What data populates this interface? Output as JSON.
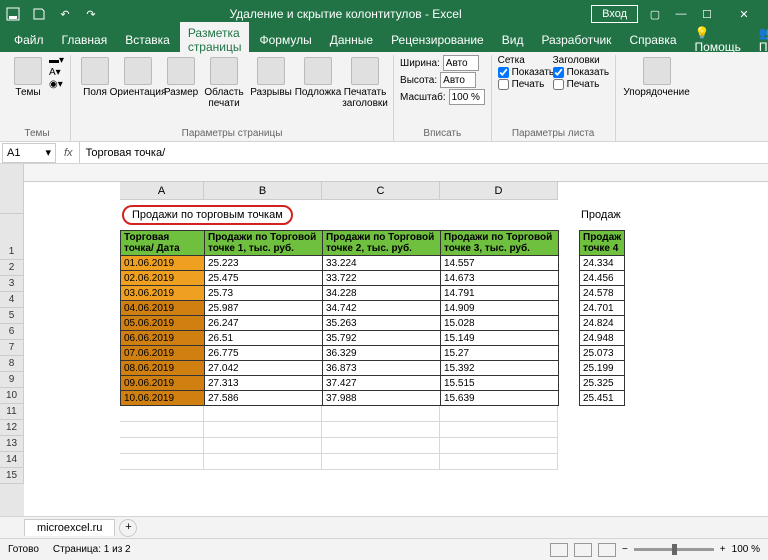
{
  "titlebar": {
    "title": "Удаление и скрытие колонтитулов - Excel",
    "login": "Вход"
  },
  "menu": {
    "items": [
      "Файл",
      "Главная",
      "Вставка",
      "Разметка страницы",
      "Формулы",
      "Данные",
      "Рецензирование",
      "Вид",
      "Разработчик",
      "Справка"
    ],
    "active": 3,
    "help_icon": "?",
    "assist": "Помощь",
    "share": "Поделиться"
  },
  "ribbon": {
    "themes": {
      "label": "Темы",
      "btn": "Темы"
    },
    "page_setup": {
      "label": "Параметры страницы",
      "btns": [
        "Поля",
        "Ориентация",
        "Размер",
        "Область печати",
        "Разрывы",
        "Подложка",
        "Печатать заголовки"
      ]
    },
    "fit": {
      "label": "Вписать",
      "width_lbl": "Ширина:",
      "width_val": "Авто",
      "height_lbl": "Высота:",
      "height_val": "Авто",
      "scale_lbl": "Масштаб:",
      "scale_val": "100 %"
    },
    "sheet_opts": {
      "label": "Параметры листа",
      "grid_lbl": "Сетка",
      "head_lbl": "Заголовки",
      "show": "Показать",
      "print": "Печать"
    },
    "arrange": {
      "label": "",
      "btn": "Упорядочение"
    }
  },
  "formula": {
    "cell": "A1",
    "value": "Торговая точка/"
  },
  "cols": [
    "A",
    "B",
    "C",
    "D"
  ],
  "header_text": "Продажи по торговым точкам",
  "header_text2": "Продаж",
  "table": {
    "headers": [
      "Торговая точка/ Дата",
      "Продажи по Торговой точке 1, тыс. руб.",
      "Продажи по Торговой точке 2, тыс. руб.",
      "Продажи по Торговой точке 3, тыс. руб."
    ],
    "header_p2": "Продаж",
    "header_p2b": "точке 4",
    "rows": [
      {
        "d": "01.06.2019",
        "v": [
          "25.223",
          "33.224",
          "14.557"
        ],
        "p2": "24.334"
      },
      {
        "d": "02.06.2019",
        "v": [
          "25.475",
          "33.722",
          "14.673"
        ],
        "p2": "24.456"
      },
      {
        "d": "03.06.2019",
        "v": [
          "25.73",
          "34.228",
          "14.791"
        ],
        "p2": "24.578"
      },
      {
        "d": "04.06.2019",
        "v": [
          "25.987",
          "34.742",
          "14.909"
        ],
        "p2": "24.701"
      },
      {
        "d": "05.06.2019",
        "v": [
          "26.247",
          "35.263",
          "15.028"
        ],
        "p2": "24.824"
      },
      {
        "d": "06.06.2019",
        "v": [
          "26.51",
          "35.792",
          "15.149"
        ],
        "p2": "24.948"
      },
      {
        "d": "07.06.2019",
        "v": [
          "26.775",
          "36.329",
          "15.27"
        ],
        "p2": "25.073"
      },
      {
        "d": "08.06.2019",
        "v": [
          "27.042",
          "36.873",
          "15.392"
        ],
        "p2": "25.199"
      },
      {
        "d": "09.06.2019",
        "v": [
          "27.313",
          "37.427",
          "15.515"
        ],
        "p2": "25.325"
      },
      {
        "d": "10.06.2019",
        "v": [
          "27.586",
          "37.988",
          "15.639"
        ],
        "p2": "25.451"
      }
    ]
  },
  "tabs": {
    "sheet": "microexcel.ru"
  },
  "status": {
    "ready": "Готово",
    "page": "Страница: 1 из 2",
    "zoom": "100 %"
  }
}
